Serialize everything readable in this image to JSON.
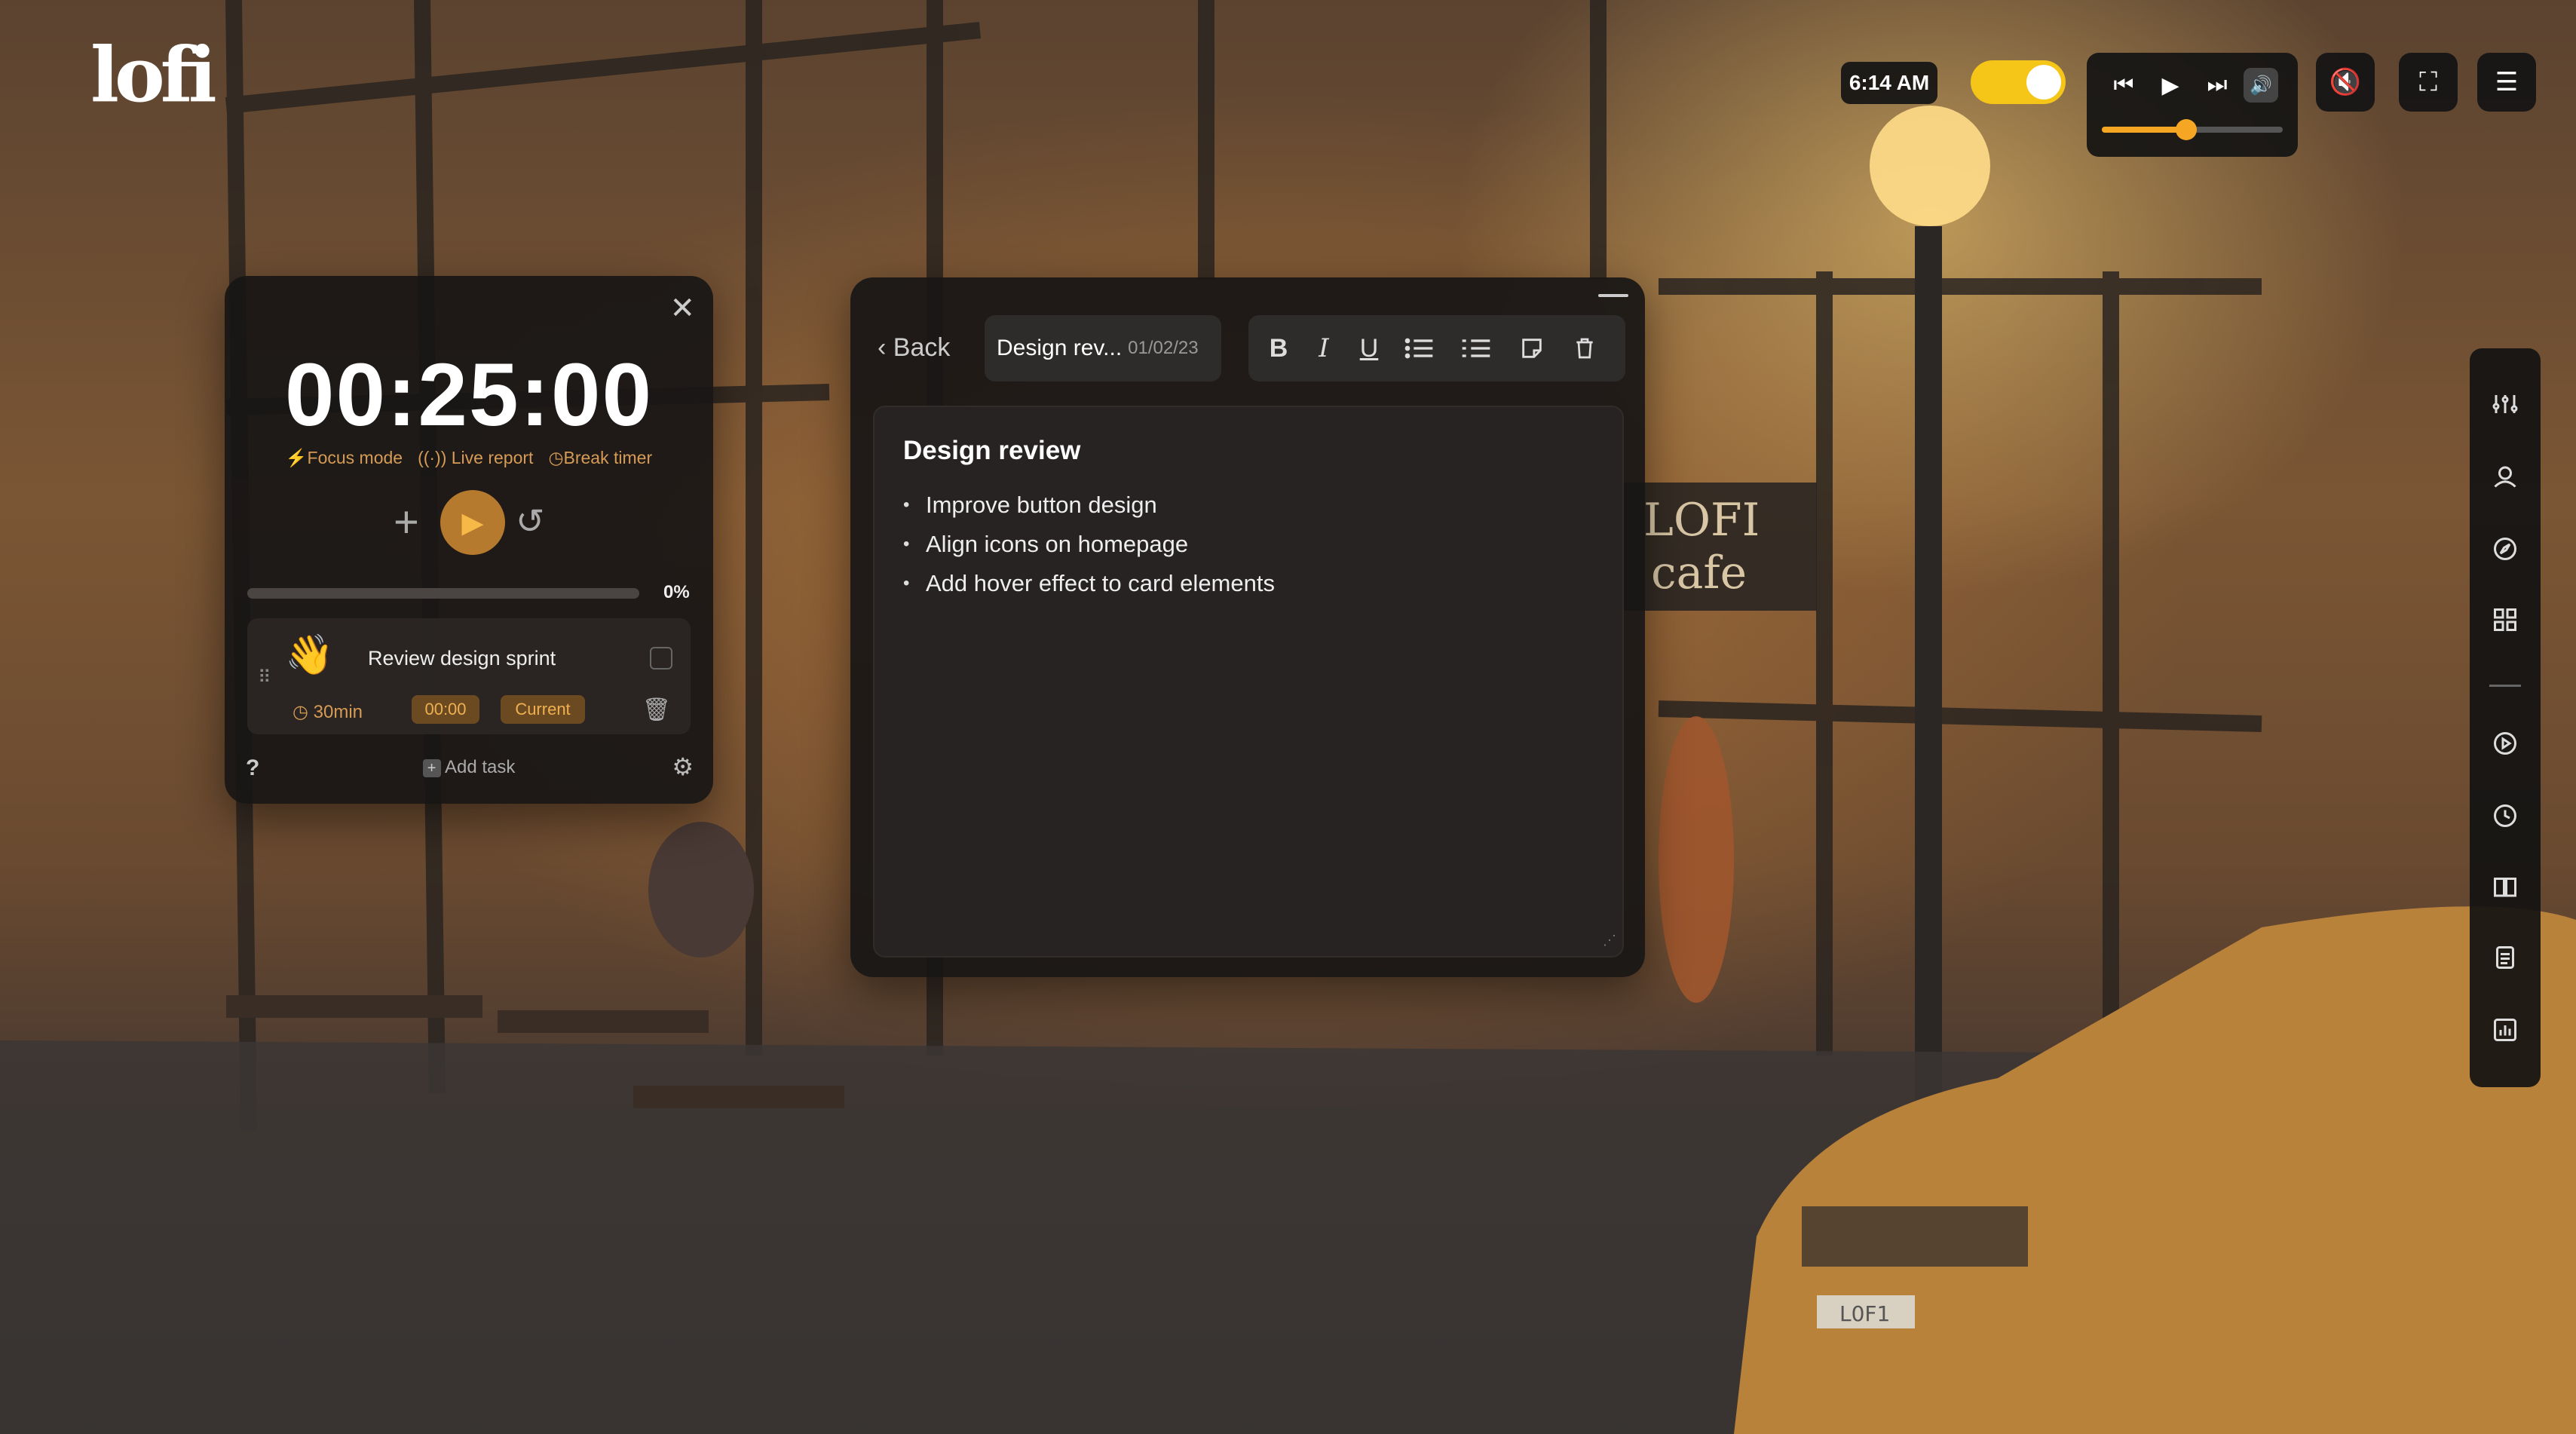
{
  "app": {
    "logo": "lofi"
  },
  "clock": {
    "time": "6:14 AM"
  },
  "theme_toggle": {
    "state": "on",
    "color": "#f5c518"
  },
  "media": {
    "prev_icon": "⏮",
    "play_icon": "▶",
    "next_icon": "⏭",
    "volume_icon": "🔊",
    "volume": 0.45
  },
  "mute": {
    "icon": "🔇"
  },
  "fullscreen": {
    "icon": "⛶"
  },
  "menu": {
    "icon": "☰"
  },
  "timer": {
    "time": "00:25:00",
    "modes": [
      {
        "icon": "⚡",
        "label": "Focus mode"
      },
      {
        "icon": "((·))",
        "label": "Live report"
      },
      {
        "icon": "◷",
        "label": "Break timer"
      }
    ],
    "progress_percent": "0%",
    "progress": 0,
    "task": {
      "emoji": "👋",
      "title": "Review design sprint",
      "duration": "30min",
      "time": "00:00",
      "status": "Current"
    },
    "help": "?",
    "add_task": "Add task"
  },
  "note": {
    "back_label": "Back",
    "title_short": "Design rev...",
    "date": "01/02/23",
    "toolbar": [
      "B",
      "I",
      "U"
    ],
    "heading": "Design review",
    "items": [
      "Improve button design",
      "Align icons on homepage",
      "Add hover effect to card elements"
    ]
  },
  "sidebar": {
    "icons": [
      "sliders-icon",
      "user-icon",
      "compass-icon",
      "grid-icon",
      "play-circle-icon",
      "clock-icon",
      "book-icon",
      "notes-icon",
      "chart-icon"
    ]
  },
  "colors": {
    "accent": "#f5a623",
    "timer_accent": "#b57a2d",
    "panel": "#181615"
  }
}
